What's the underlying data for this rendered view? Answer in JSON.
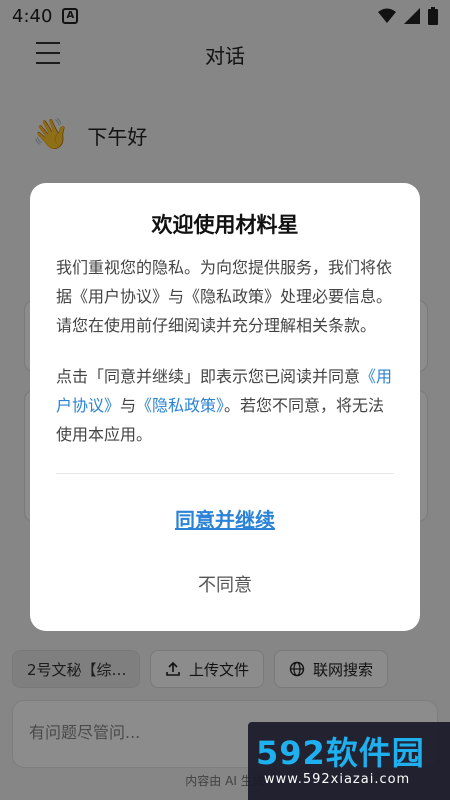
{
  "status": {
    "time": "4:40",
    "badge": "A"
  },
  "appbar": {
    "title": "对话"
  },
  "greeting": {
    "emoji": "👋",
    "text": "下午好"
  },
  "controls": {
    "assistant_chip": "2号文秘【综…",
    "upload_label": "上传文件",
    "search_label": "联网搜索"
  },
  "input": {
    "placeholder": "有问题尽管问..."
  },
  "footer": {
    "note": "内容由 AI 生成"
  },
  "dialog": {
    "title": "欢迎使用材料星",
    "para1": "我们重视您的隐私。为向您提供服务，我们将依据《用户协议》与《隐私政策》处理必要信息。请您在使用前仔细阅读并充分理解相关条款。",
    "para2_prefix": "点击「同意并继续」即表示您已阅读并同意",
    "link_user_agreement": "《用户协议》",
    "para2_and": "与",
    "link_privacy_policy": "《隐私政策》",
    "para2_suffix": "。若您不同意，将无法使用本应用。",
    "agree_label": "同意并继续",
    "disagree_label": "不同意"
  },
  "watermark": {
    "logo": "592软件园",
    "url": "www.592xiazai.com"
  },
  "colors": {
    "link": "#2a83d6",
    "overlay": "rgba(0,0,0,0.45)"
  }
}
